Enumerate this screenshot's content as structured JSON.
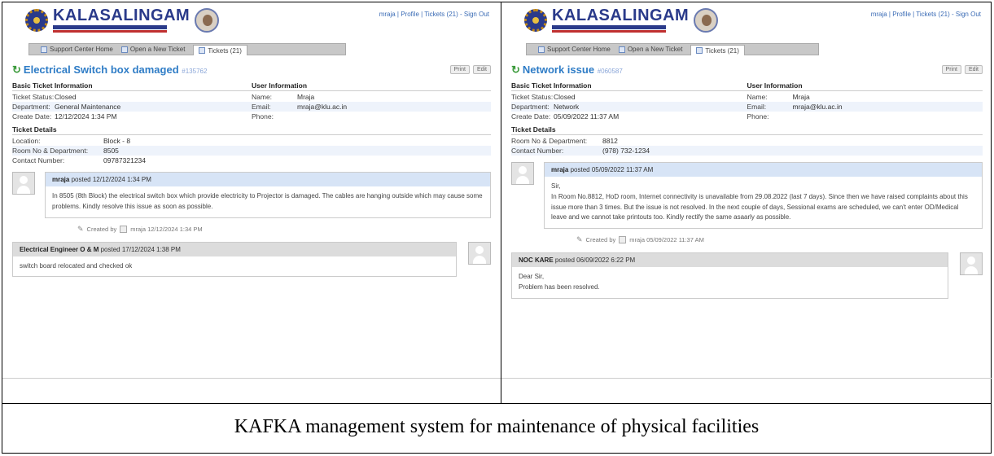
{
  "caption": "KAFKA management system for maintenance of physical facilities",
  "panels": {
    "left": {
      "brand": "KALASALINGAM",
      "toplinks": "mraja | Profile | Tickets (21) - Sign Out",
      "nav": [
        "Support Center Home",
        "Open a New Ticket",
        "Tickets (21)"
      ],
      "title": "Electrical Switch box damaged",
      "ticket_no": "#135762",
      "btns": [
        "Print",
        "Edit"
      ],
      "basic_head": "Basic Ticket Information",
      "user_head": "User Information",
      "basic": [
        {
          "k": "Ticket Status:",
          "v": "Closed"
        },
        {
          "k": "Department:",
          "v": "General Maintenance"
        },
        {
          "k": "Create Date:",
          "v": "12/12/2024 1:34 PM"
        }
      ],
      "user": [
        {
          "k": "Name:",
          "v": "Mraja"
        },
        {
          "k": "Email:",
          "v": "mraja@klu.ac.in"
        },
        {
          "k": "Phone:",
          "v": ""
        }
      ],
      "details_head": "Ticket Details",
      "details": [
        {
          "k": "Location:",
          "v": "Block - 8"
        },
        {
          "k": "Room No & Department:",
          "v": "8505"
        },
        {
          "k": "Contact Number:",
          "v": "09787321234"
        }
      ],
      "post_author": "mraja",
      "post_date": "posted 12/12/2024 1:34 PM",
      "post_body": "In 8505 (8th Block) the electrical switch box which provide electricity to Projector is damaged. The cables are hanging outside which may cause some problems. Kindly resolve this issue as soon as possible.",
      "created_by": "Created by",
      "created_meta": "mraja 12/12/2024 1:34 PM",
      "reply_author": "Electrical Engineer O & M",
      "reply_date": "posted 17/12/2024 1:38 PM",
      "reply_body": "switch board relocated and checked ok"
    },
    "right": {
      "brand": "KALASALINGAM",
      "toplinks": "mraja | Profile | Tickets (21) - Sign Out",
      "nav": [
        "Support Center Home",
        "Open a New Ticket",
        "Tickets (21)"
      ],
      "title": "Network issue",
      "ticket_no": "#060587",
      "btns": [
        "Print",
        "Edit"
      ],
      "basic_head": "Basic Ticket Information",
      "user_head": "User Information",
      "basic": [
        {
          "k": "Ticket Status:",
          "v": "Closed"
        },
        {
          "k": "Department:",
          "v": "Network"
        },
        {
          "k": "Create Date:",
          "v": "05/09/2022 11:37 AM"
        }
      ],
      "user": [
        {
          "k": "Name:",
          "v": "Mraja"
        },
        {
          "k": "Email:",
          "v": "mraja@klu.ac.in"
        },
        {
          "k": "Phone:",
          "v": ""
        }
      ],
      "details_head": "Ticket Details",
      "details": [
        {
          "k": "Room No & Department:",
          "v": "8812"
        },
        {
          "k": "Contact Number:",
          "v": "(978) 732-1234"
        }
      ],
      "post_author": "mraja",
      "post_date": "posted 05/09/2022 11:37 AM",
      "post_greeting": "Sir,",
      "post_body": "In Room No.8812, HoD room, Internet connectivity is unavailable from 29.08.2022 (last 7 days). Since then we have raised complaints about this issue more than 3 times. But the issue is not resolved. In the next couple of days, Sessional exams are scheduled, we can't enter OD/Medical leave and we cannot take printouts too. Kindly rectify the same asaarly as possible.",
      "created_by": "Created by",
      "created_meta": "mraja 05/09/2022 11:37 AM",
      "reply_author": "NOC KARE",
      "reply_date": "posted 06/09/2022 6:22 PM",
      "reply_greeting": "Dear Sir,",
      "reply_body": "Problem has been resolved."
    }
  }
}
